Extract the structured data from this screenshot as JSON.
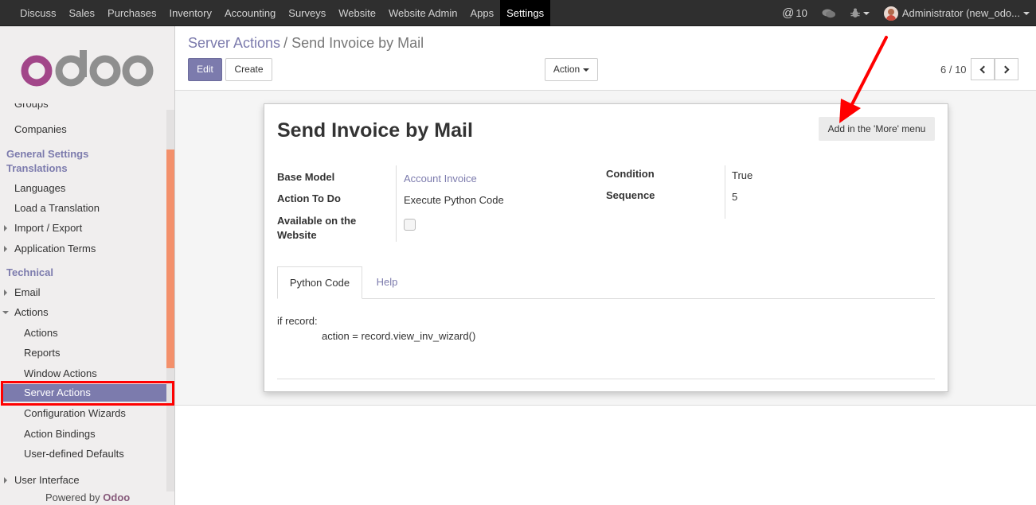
{
  "topbar": {
    "menu": [
      "Discuss",
      "Sales",
      "Purchases",
      "Inventory",
      "Accounting",
      "Surveys",
      "Website",
      "Website Admin",
      "Apps",
      "Settings"
    ],
    "active": "Settings",
    "messages_count": "10",
    "user": "Administrator (new_odo..."
  },
  "sidebar": {
    "groups_partial": "Groups",
    "companies": "Companies",
    "general_settings": "General Settings",
    "translations": "Translations",
    "languages": "Languages",
    "load_translation": "Load a Translation",
    "import_export": "Import / Export",
    "application_terms": "Application Terms",
    "technical": "Technical",
    "email": "Email",
    "actions": "Actions",
    "actions_sub": "Actions",
    "reports": "Reports",
    "window_actions": "Window Actions",
    "server_actions": "Server Actions",
    "configuration_wizards": "Configuration Wizards",
    "action_bindings": "Action Bindings",
    "user_defined_defaults": "User-defined Defaults",
    "user_interface": "User Interface",
    "powered_by": "Powered by",
    "brand": "Odoo",
    "accent_color": "#7c7bad"
  },
  "control_panel": {
    "breadcrumb_parent": "Server Actions",
    "breadcrumb_sep": "/",
    "breadcrumb_current": "Send Invoice by Mail",
    "edit_label": "Edit",
    "create_label": "Create",
    "action_label": "Action",
    "pager": "6 / 10"
  },
  "form": {
    "title": "Send Invoice by Mail",
    "more_menu_button": "Add in the 'More' menu",
    "base_model_label": "Base Model",
    "base_model_value": "Account Invoice",
    "action_to_do_label": "Action To Do",
    "action_to_do_value": "Execute Python Code",
    "available_website_label_1": "Available on the",
    "available_website_label_2": "Website",
    "available_website_checked": false,
    "condition_label": "Condition",
    "condition_value": "True",
    "sequence_label": "Sequence",
    "sequence_value": "5",
    "tab_python_code": "Python Code",
    "tab_help": "Help",
    "code_line_1": "if record:",
    "code_line_2": "action = record.view_inv_wizard()"
  },
  "annotations": {
    "arrow_color": "#ff0000",
    "highlight_color": "#ff0000"
  }
}
